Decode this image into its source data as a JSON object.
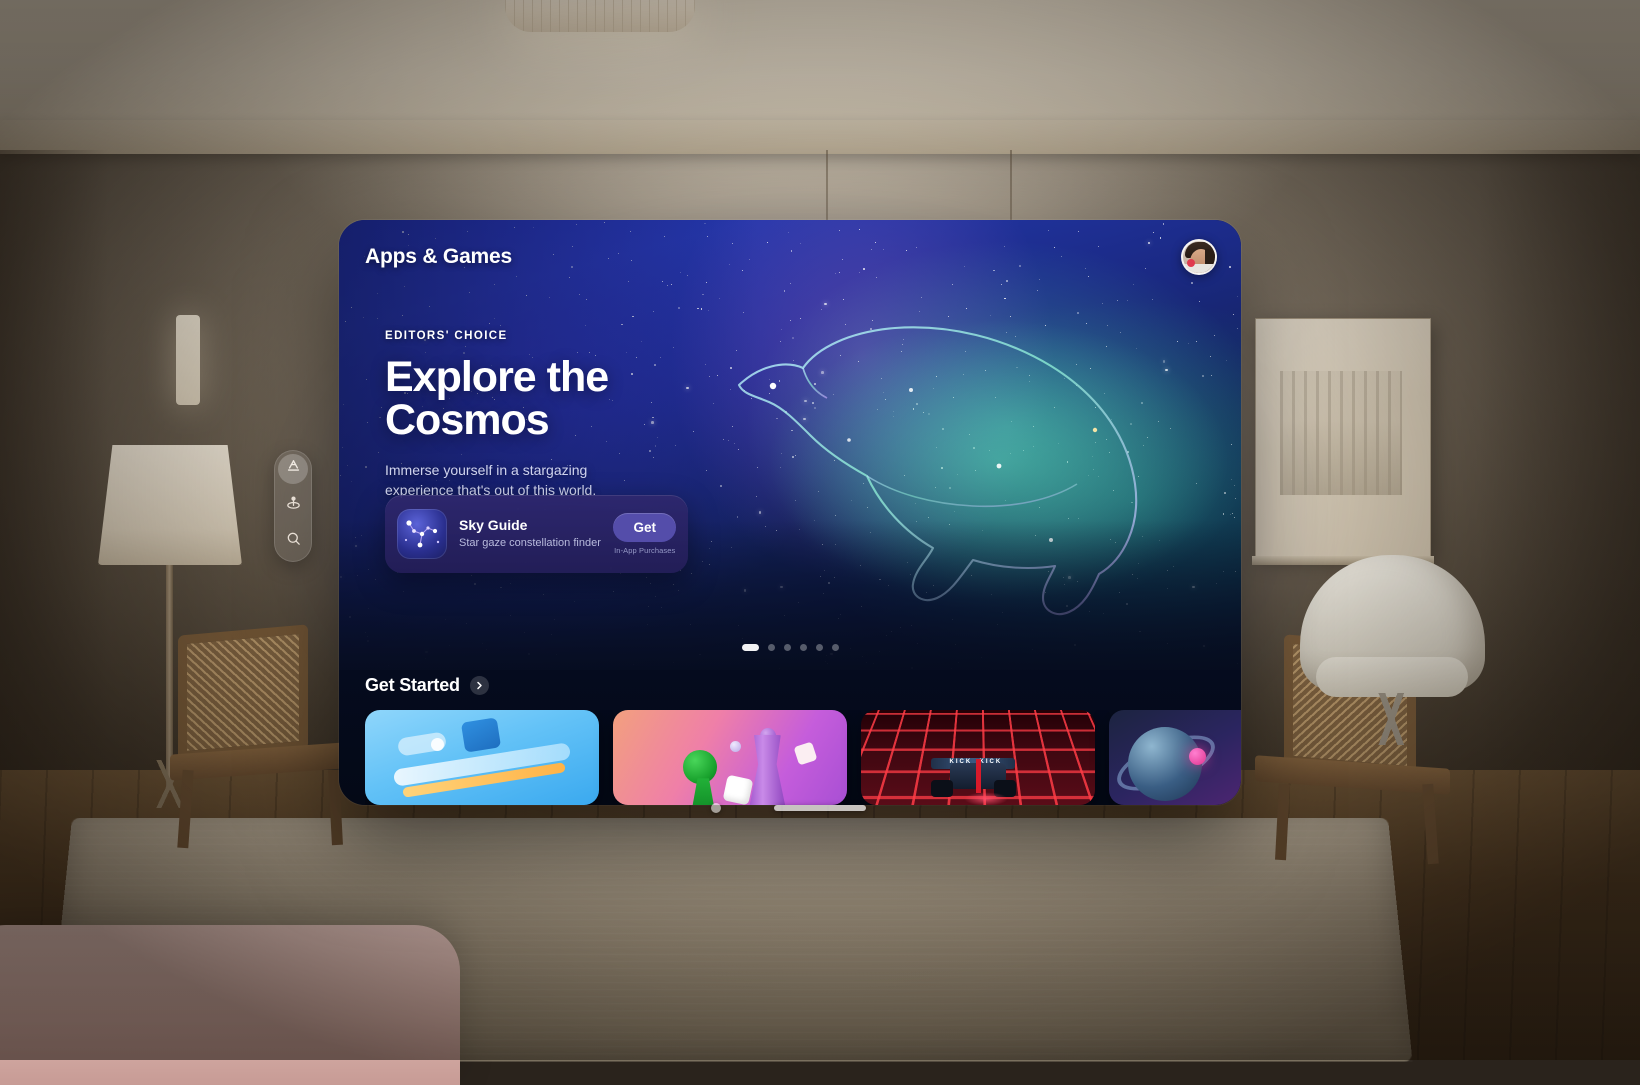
{
  "scene": {
    "environment": "living-room",
    "device": "spatial-headset-window"
  },
  "toolbar": {
    "items": [
      {
        "id": "apps",
        "label": "Apps",
        "icon": "app-store-icon",
        "active": true
      },
      {
        "id": "arcade",
        "label": "Arcade",
        "icon": "arcade-joystick-icon",
        "active": false
      },
      {
        "id": "search",
        "label": "Search",
        "icon": "search-icon",
        "active": false
      }
    ]
  },
  "window": {
    "title": "Apps & Games",
    "avatar": {
      "name": "user-avatar",
      "alt": "Account profile photo"
    },
    "hero": {
      "eyebrow": "EDITORS' CHOICE",
      "headline_line1": "Explore the",
      "headline_line2": "Cosmos",
      "subhead": "Immerse yourself in a stargazing experience that's out of this world.",
      "artwork": "polar-bear-constellation",
      "app_card": {
        "icon": "constellation-icon",
        "name": "Sky Guide",
        "subtitle": "Star gaze constellation finder",
        "action_label": "Get",
        "note": "In-App Purchases"
      },
      "pagination": {
        "total": 6,
        "active_index": 0
      }
    },
    "section": {
      "title": "Get Started",
      "chevron": "chevron-right-icon",
      "cards": [
        {
          "id": "card-1",
          "art": "productivity-blue-abstract"
        },
        {
          "id": "card-2",
          "art": "board-game-pieces-dice"
        },
        {
          "id": "card-3",
          "art": "racing-car-neon-grid"
        },
        {
          "id": "card-4",
          "art": "space-planet-orb"
        }
      ]
    },
    "chrome": {
      "close_dot": "window-close-dot",
      "resize_handle": "window-resize-handle"
    }
  },
  "colors": {
    "accent": "#5650af",
    "hero_blue": "#1f2fa8",
    "hero_deep": "#060d23",
    "text_primary": "#ffffff"
  }
}
